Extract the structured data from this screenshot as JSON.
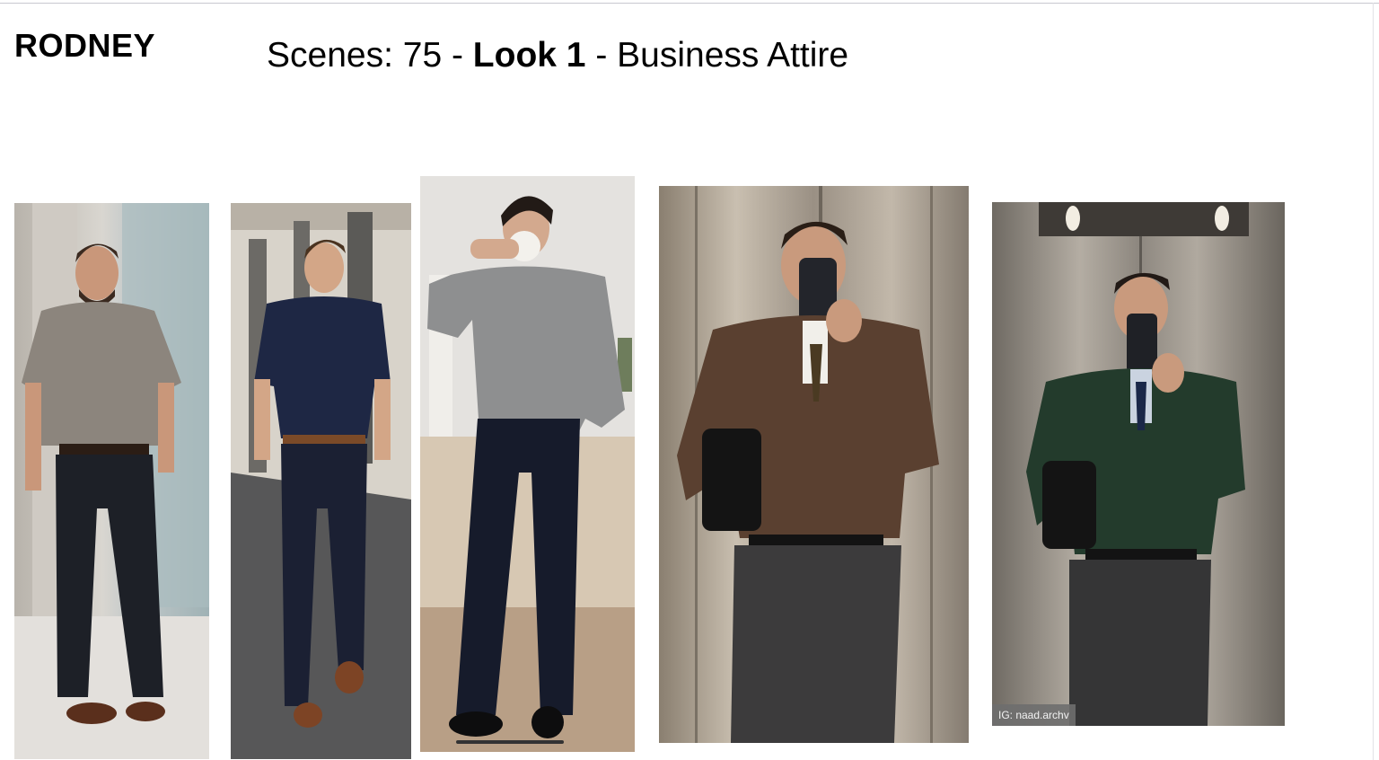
{
  "slide": {
    "character_name": "RODNEY",
    "title": {
      "prefix": "Scenes: 75 - ",
      "look": "Look 1",
      "suffix": " - Business Attire"
    }
  },
  "photos": [
    {
      "subject": "man in taupe polo shirt, black trousers, brown shoes, lobby"
    },
    {
      "subject": "man in navy polo shirt, navy trousers, brown loafers, street"
    },
    {
      "subject": "man in grey crewneck sweater drinking from mug, navy trousers, black loafers"
    },
    {
      "subject": "mirror selfie, brown quarter-zip sweater, tie, charcoal trousers, elevator"
    },
    {
      "subject": "mirror selfie, green quarter-zip sweater, navy tie, charcoal trousers, elevator",
      "credit": "IG: naad.archv"
    }
  ],
  "colors": {
    "text": "#000000",
    "background": "#ffffff"
  }
}
